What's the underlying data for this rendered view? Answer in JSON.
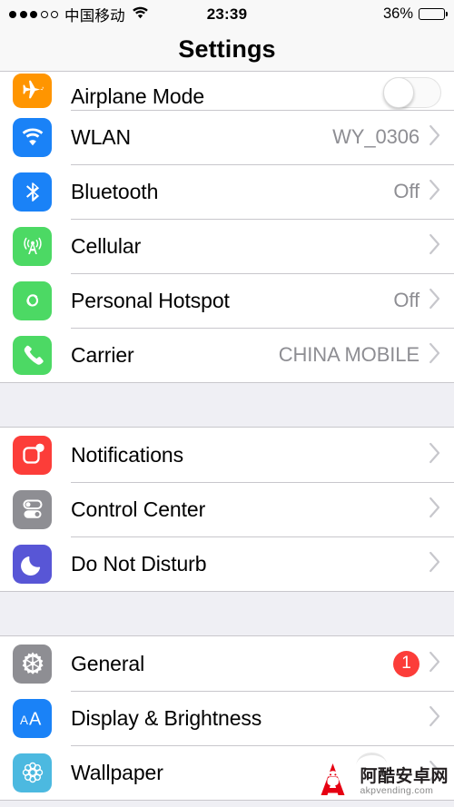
{
  "statusbar": {
    "signal_dots_filled": 3,
    "signal_dots_total": 5,
    "carrier": "中国移动",
    "wifi_icon": "wifi-icon",
    "time": "23:39",
    "battery_percent": "36%",
    "battery_level": 36
  },
  "navbar": {
    "title": "Settings"
  },
  "groups": [
    {
      "id": "connectivity",
      "cut_top": true,
      "rows": [
        {
          "id": "airplane-mode",
          "label": "Airplane Mode",
          "icon": "airplane-icon",
          "icon_color": "#ff9500",
          "accessory": "toggle",
          "toggle_on": false,
          "partial": true
        },
        {
          "id": "wlan",
          "label": "WLAN",
          "icon": "wifi-icon",
          "icon_color": "#1a82f7",
          "accessory": "disclosure",
          "value": "WY_0306"
        },
        {
          "id": "bluetooth",
          "label": "Bluetooth",
          "icon": "bluetooth-icon",
          "icon_color": "#1a82f7",
          "accessory": "disclosure",
          "value": "Off"
        },
        {
          "id": "cellular",
          "label": "Cellular",
          "icon": "cellular-antenna-icon",
          "icon_color": "#4cd964",
          "accessory": "disclosure",
          "value": ""
        },
        {
          "id": "personal-hotspot",
          "label": "Personal Hotspot",
          "icon": "hotspot-link-icon",
          "icon_color": "#4cd964",
          "accessory": "disclosure",
          "value": "Off"
        },
        {
          "id": "carrier",
          "label": "Carrier",
          "icon": "phone-icon",
          "icon_color": "#4cd964",
          "accessory": "disclosure",
          "value": "CHINA MOBILE"
        }
      ]
    },
    {
      "id": "notifications-group",
      "cut_top": false,
      "rows": [
        {
          "id": "notifications",
          "label": "Notifications",
          "icon": "notifications-badge-icon",
          "icon_color": "#fc3d39",
          "accessory": "disclosure",
          "value": ""
        },
        {
          "id": "control-center",
          "label": "Control Center",
          "icon": "control-center-toggles-icon",
          "icon_color": "#8e8e93",
          "accessory": "disclosure",
          "value": ""
        },
        {
          "id": "do-not-disturb",
          "label": "Do Not Disturb",
          "icon": "moon-icon",
          "icon_color": "#5856d6",
          "accessory": "disclosure",
          "value": ""
        }
      ]
    },
    {
      "id": "general-group",
      "cut_top": false,
      "rows": [
        {
          "id": "general",
          "label": "General",
          "icon": "gear-icon",
          "icon_color": "#8e8e93",
          "accessory": "disclosure",
          "value": "",
          "badge": "1"
        },
        {
          "id": "display-brightness",
          "label": "Display & Brightness",
          "icon": "text-size-aa-icon",
          "icon_color": "#1a82f7",
          "accessory": "disclosure",
          "value": ""
        },
        {
          "id": "wallpaper",
          "label": "Wallpaper",
          "icon": "wallpaper-flower-icon",
          "icon_color": "#4cb9e0",
          "accessory": "disclosure",
          "value": ""
        }
      ]
    }
  ],
  "watermark": {
    "site_name": "阿酷安卓网",
    "url": "akpvending.com",
    "logo": "android-a-logo-icon",
    "logo_color": "#e60012"
  },
  "colors": {
    "background": "#efeff4",
    "row_background": "#ffffff",
    "separator": "#c8c7cc",
    "secondary_text": "#8e8e93",
    "badge_red": "#fc3d39",
    "toggle_on": "#4cd964"
  }
}
